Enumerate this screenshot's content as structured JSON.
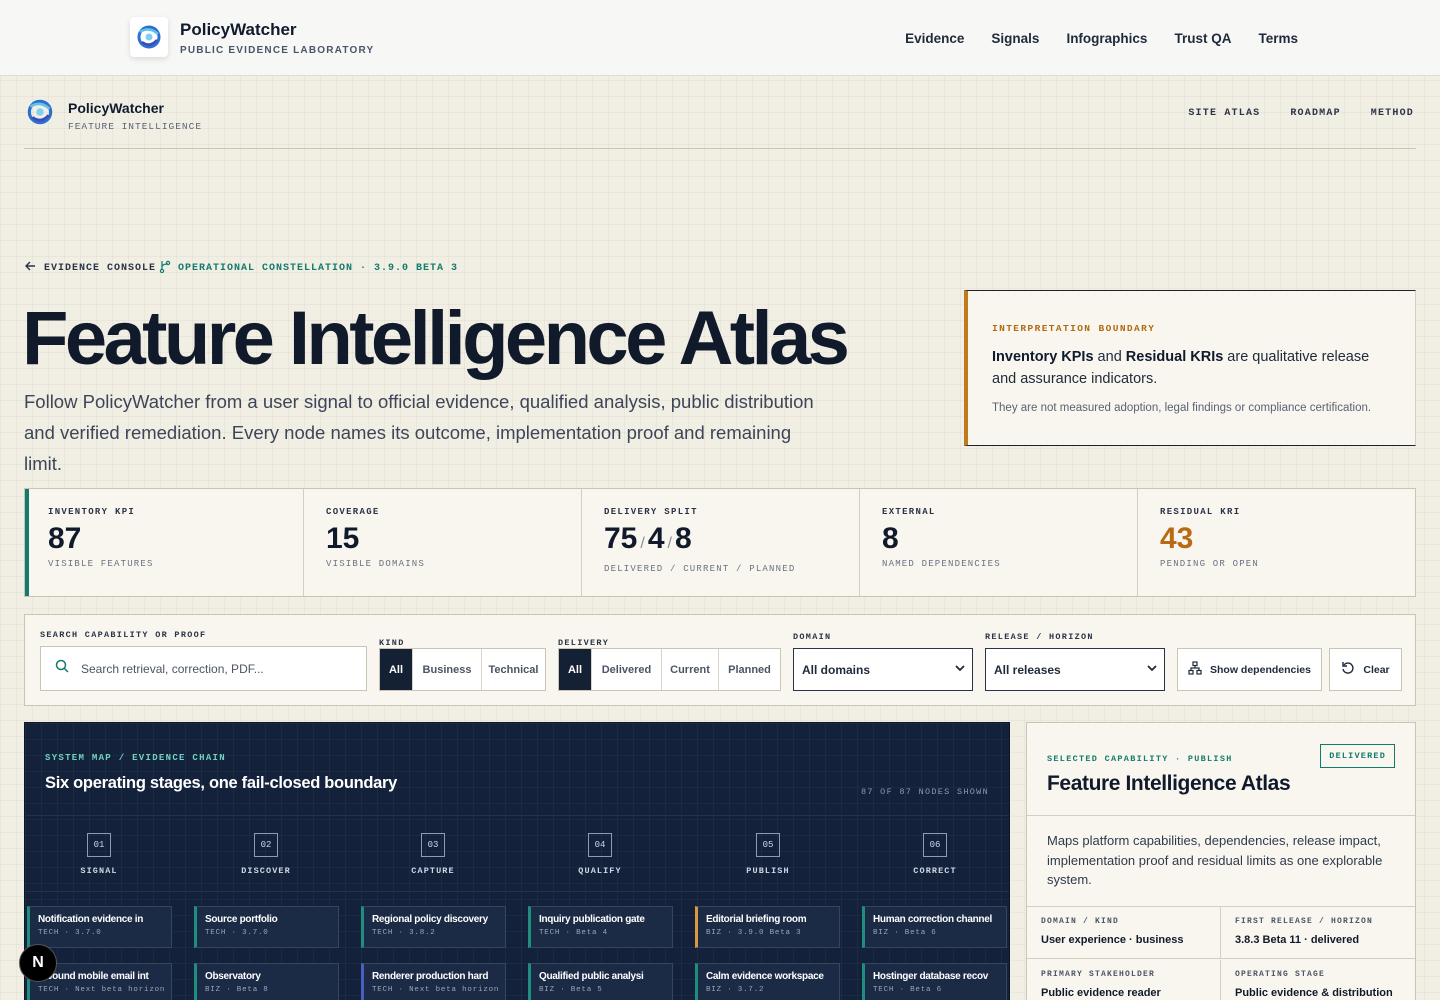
{
  "topbar": {
    "brand": "PolicyWatcher",
    "tagline": "PUBLIC EVIDENCE LABORATORY",
    "nav": [
      "Evidence",
      "Signals",
      "Infographics",
      "Trust QA",
      "Terms"
    ]
  },
  "subheader": {
    "brand": "PolicyWatcher",
    "tagline": "FEATURE INTELLIGENCE",
    "nav": [
      "SITE ATLAS",
      "ROADMAP",
      "METHOD"
    ]
  },
  "breadcrumb": {
    "back": "EVIDENCE CONSOLE",
    "current": "OPERATIONAL CONSTELLATION · 3.9.0 BETA 3"
  },
  "hero": {
    "title": "Feature Intelligence Atlas",
    "description": "Follow PolicyWatcher from a user signal to official evidence, qualified analysis, public distribution and verified remediation. Every node names its outcome, implementation proof and remaining limit."
  },
  "boundary": {
    "label": "INTERPRETATION BOUNDARY",
    "term1": "Inventory KPIs",
    "joiner": " and ",
    "term2": "Residual KRIs",
    "rest": " are qualitative release and assurance indicators.",
    "note": "They are not measured adoption, legal findings or compliance certification."
  },
  "kpis": {
    "inventory": {
      "label": "INVENTORY KPI",
      "value": "87",
      "sub": "VISIBLE FEATURES"
    },
    "coverage": {
      "label": "COVERAGE",
      "value": "15",
      "sub": "VISIBLE DOMAINS"
    },
    "delivery": {
      "label": "DELIVERY SPLIT",
      "delivered": "75",
      "current": "4",
      "planned": "8",
      "sub": "DELIVERED / CURRENT / PLANNED"
    },
    "external": {
      "label": "EXTERNAL",
      "value": "8",
      "sub": "NAMED DEPENDENCIES"
    },
    "residual": {
      "label": "RESIDUAL KRI",
      "value": "43",
      "sub": "PENDING OR OPEN"
    }
  },
  "filters": {
    "search_label": "SEARCH CAPABILITY OR PROOF",
    "search_placeholder": "Search retrieval, correction, PDF...",
    "kind_label": "KIND",
    "kind_options": [
      "All",
      "Business",
      "Technical"
    ],
    "delivery_label": "DELIVERY",
    "delivery_options": [
      "All",
      "Delivered",
      "Current",
      "Planned"
    ],
    "domain_label": "DOMAIN",
    "domain_value": "All domains",
    "release_label": "RELEASE / HORIZON",
    "release_value": "All releases",
    "show_deps": "Show dependencies",
    "clear": "Clear"
  },
  "map": {
    "kicker": "SYSTEM MAP / EVIDENCE CHAIN",
    "title": "Six operating stages, one fail-closed boundary",
    "count": "87 OF 87 NODES SHOWN",
    "stages": [
      {
        "num": "01",
        "name": "SIGNAL"
      },
      {
        "num": "02",
        "name": "DISCOVER"
      },
      {
        "num": "03",
        "name": "CAPTURE"
      },
      {
        "num": "04",
        "name": "QUALIFY"
      },
      {
        "num": "05",
        "name": "PUBLISH"
      },
      {
        "num": "06",
        "name": "CORRECT"
      }
    ],
    "row1": [
      {
        "title": "Notification evidence in",
        "meta": "TECH · 3.7.0",
        "accent": "teal"
      },
      {
        "title": "Source portfolio",
        "meta": "TECH · 3.7.0",
        "accent": "teal"
      },
      {
        "title": "Regional policy discovery",
        "meta": "TECH · 3.8.2",
        "accent": "teal"
      },
      {
        "title": "Inquiry publication gate",
        "meta": "TECH · Beta 4",
        "accent": "teal"
      },
      {
        "title": "Editorial briefing room",
        "meta": "BIZ · 3.9.0 Beta 3",
        "accent": "amber"
      },
      {
        "title": "Human correction channel",
        "meta": "BIZ · Beta 6",
        "accent": "teal"
      }
    ],
    "row2": [
      {
        "title": "Inbound mobile email int",
        "meta": "TECH · Next beta horizon",
        "accent": "teal"
      },
      {
        "title": "Observatory",
        "meta": "BIZ · Beta 8",
        "accent": "teal"
      },
      {
        "title": "Renderer production hard",
        "meta": "TECH · Next beta horizon",
        "accent": "blue"
      },
      {
        "title": "Qualified public analysi",
        "meta": "BIZ · Beta 5",
        "accent": "teal"
      },
      {
        "title": "Calm evidence workspace",
        "meta": "BIZ · 3.7.2",
        "accent": "teal"
      },
      {
        "title": "Hostinger database recov",
        "meta": "TECH · Beta 6",
        "accent": "teal"
      }
    ]
  },
  "panel": {
    "kicker": "SELECTED CAPABILITY · PUBLISH",
    "title": "Feature Intelligence Atlas",
    "badge": "DELIVERED",
    "description": "Maps platform capabilities, dependencies, release impact, implementation proof and residual limits as one explorable system.",
    "cells": [
      {
        "label": "DOMAIN / KIND",
        "value": "User experience · business"
      },
      {
        "label": "FIRST RELEASE / HORIZON",
        "value": "3.8.3 Beta 11 · delivered"
      },
      {
        "label": "PRIMARY STAKEHOLDER",
        "value": "Public evidence reader"
      },
      {
        "label": "OPERATING STAGE",
        "value": "Public evidence & distribution"
      }
    ]
  },
  "fab": {
    "label": "N"
  },
  "colors": {
    "teal": "#137b6d",
    "amber": "#b86b14",
    "navy": "#13213a",
    "cream": "#f1eee4"
  }
}
